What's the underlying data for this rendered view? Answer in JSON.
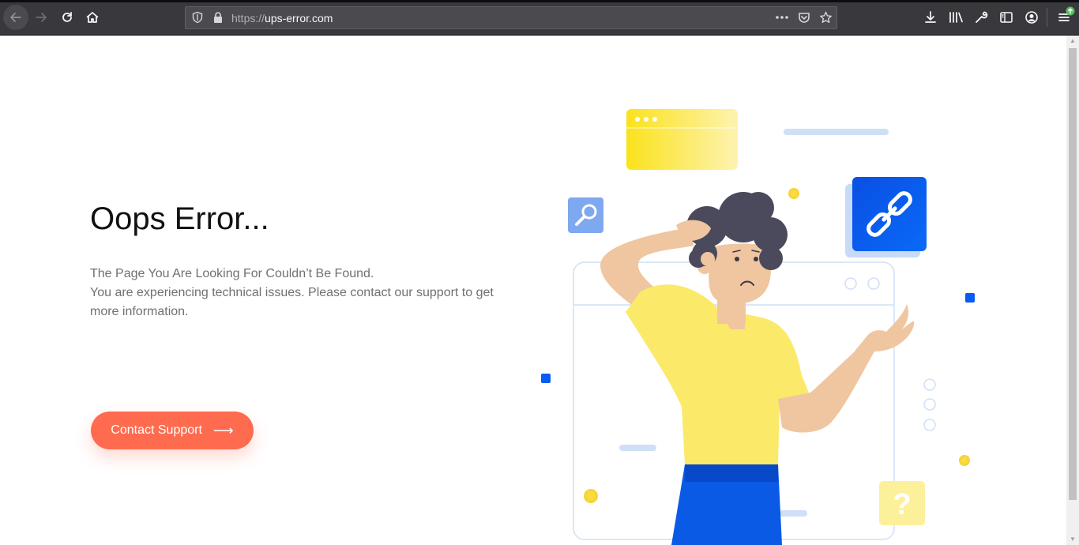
{
  "browser": {
    "url_protocol": "https://",
    "url_host": "ups-error.com",
    "icons": {
      "back": "back-arrow-icon",
      "forward": "forward-arrow-icon",
      "reload": "reload-icon",
      "home": "home-icon",
      "shield": "tracking-shield-icon",
      "lock": "lock-icon",
      "more": "more-actions-icon",
      "pocket": "pocket-icon",
      "bookmark": "star-icon",
      "downloads": "download-icon",
      "library": "library-icon",
      "tools": "wrench-icon",
      "sidebar": "sidebar-icon",
      "account": "account-icon",
      "menu": "hamburger-menu-icon"
    }
  },
  "page": {
    "title": "Oops Error...",
    "line1": "The Page You Are Looking For Couldn’t Be Found.",
    "line2": "You are experiencing technical issues. Please contact our support to get more information.",
    "cta_label": "Contact Support",
    "cta_arrow": "⟶",
    "question_mark": "?"
  },
  "colors": {
    "accent": "#ff6b4f",
    "blue": "#0a5bf5",
    "yellow": "#ffe44d",
    "shirt": "#fbe96a",
    "pants": "#0a5ae6",
    "hair": "#4b4a5c",
    "skin": "#efc6a0"
  }
}
